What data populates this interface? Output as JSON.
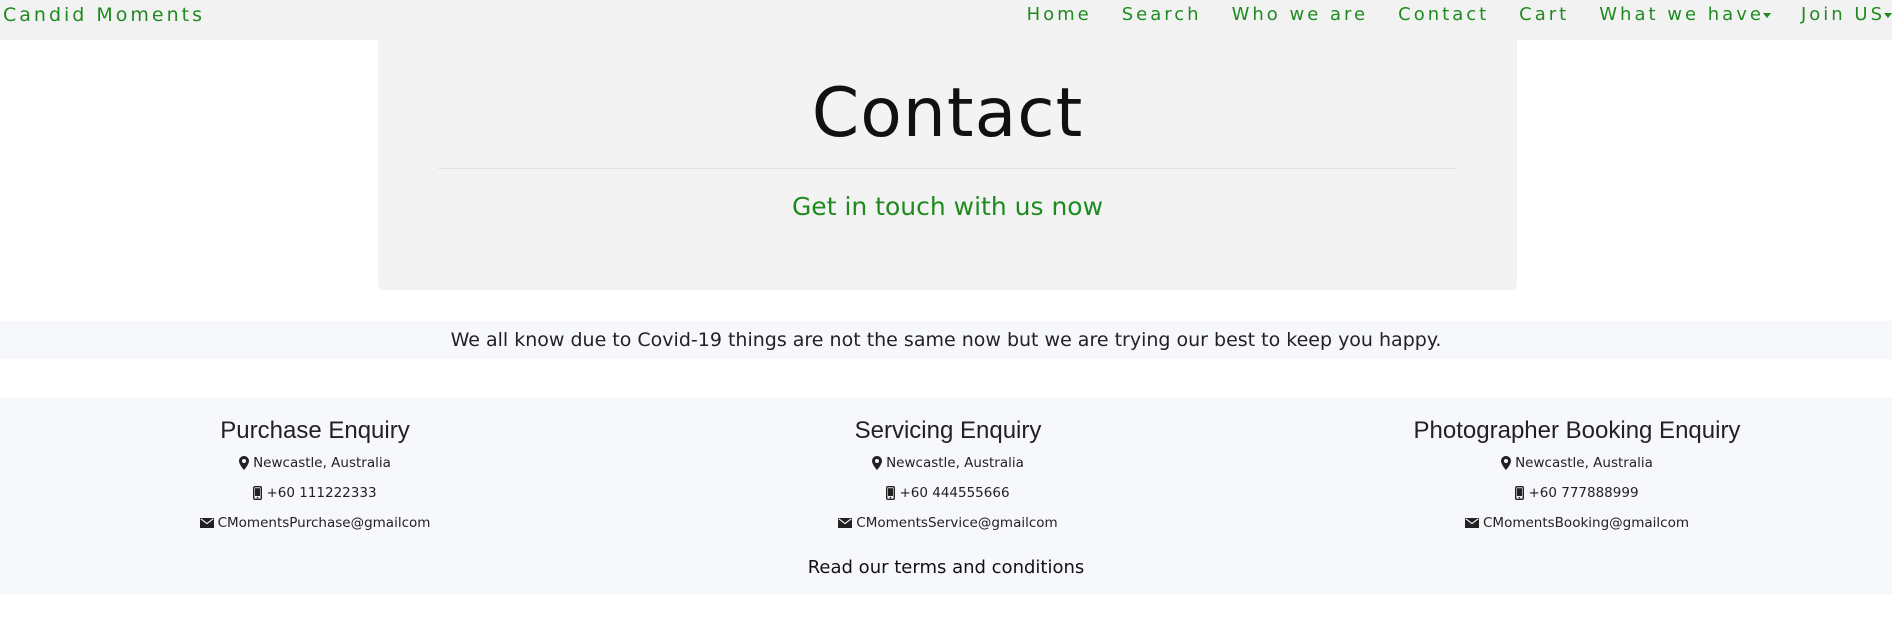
{
  "brand": "Candid Moments",
  "nav": {
    "items": [
      "Home",
      "Search",
      "Who we are",
      "Contact",
      "Cart",
      "What we have",
      "Join US"
    ]
  },
  "jumbotron": {
    "title": "Contact",
    "subtitle": "Get in touch with us now"
  },
  "notice": "We all know due to Covid-19 things are not the same now but we are trying our best to keep you happy.",
  "enquiries": [
    {
      "title": "Purchase Enquiry",
      "location": "Newcastle, Australia",
      "phone": "+60 111222333",
      "email": "CMomentsPurchase@gmailcom"
    },
    {
      "title": "Servicing Enquiry",
      "location": "Newcastle, Australia",
      "phone": "+60 444555666",
      "email": "CMomentsService@gmailcom"
    },
    {
      "title": "Photographer Booking Enquiry",
      "location": "Newcastle, Australia",
      "phone": "+60 777888999",
      "email": "CMomentsBooking@gmailcom"
    }
  ],
  "terms_link": "Read our terms and conditions",
  "colors": {
    "brand_green": "#1f8a1f",
    "navbar_bg": "#f2f2f2",
    "jumbotron_bg": "#f3f3f3",
    "band_bg": "#f7f8fb"
  },
  "icons": {
    "location": "map-marker-icon",
    "phone": "mobile-phone-icon",
    "email": "envelope-icon",
    "dropdown": "caret-down-icon"
  }
}
